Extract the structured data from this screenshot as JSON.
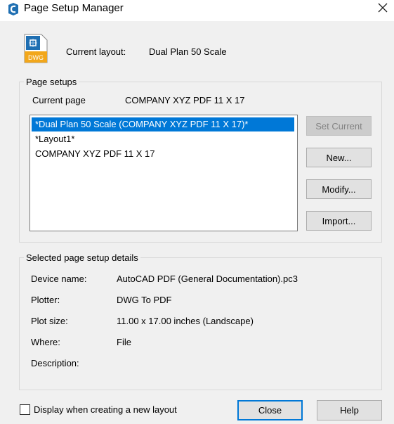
{
  "window": {
    "title": "Page Setup Manager"
  },
  "current_layout": {
    "label": "Current layout:",
    "value": "Dual Plan 50 Scale",
    "icon_text": "DWG"
  },
  "page_setups": {
    "group_title": "Page setups",
    "current_page_label": "Current page",
    "current_page_value": "COMPANY XYZ PDF 11 X 17",
    "items": [
      "*Dual Plan 50 Scale (COMPANY XYZ PDF 11 X 17)*",
      "*Layout1*",
      "COMPANY XYZ PDF 11 X 17"
    ],
    "selected_index": 0,
    "buttons": {
      "set_current": "Set Current",
      "new": "New...",
      "modify": "Modify...",
      "import": "Import..."
    }
  },
  "details": {
    "group_title": "Selected page setup details",
    "device_name_label": "Device name:",
    "device_name_value": "AutoCAD PDF (General Documentation).pc3",
    "plotter_label": "Plotter:",
    "plotter_value": "DWG To PDF",
    "plot_size_label": "Plot size:",
    "plot_size_value": "11.00 x 17.00 inches (Landscape)",
    "where_label": "Where:",
    "where_value": "File",
    "description_label": "Description:"
  },
  "footer": {
    "checkbox_label": "Display when creating a new layout",
    "checkbox_checked": false,
    "close": "Close",
    "help": "Help"
  },
  "colors": {
    "selection": "#0078d7",
    "dialog_bg": "#f0f0f0",
    "accent_icon": "#1f6fb2",
    "dwg_badge": "#f2a71b"
  }
}
